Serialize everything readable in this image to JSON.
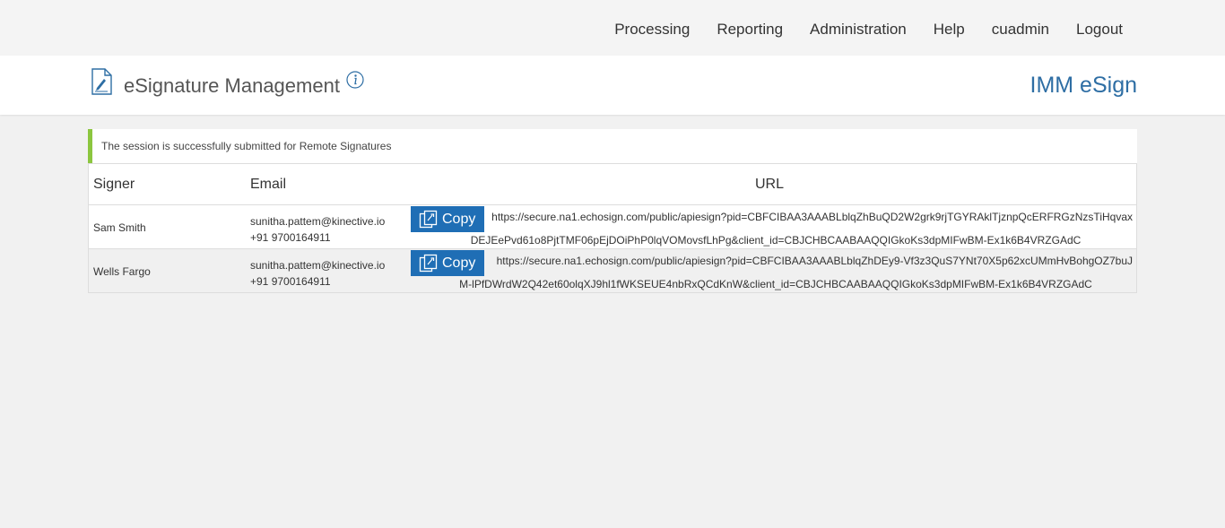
{
  "nav": {
    "items": [
      "Processing",
      "Reporting",
      "Administration",
      "Help",
      "cuadmin",
      "Logout"
    ]
  },
  "header": {
    "title": "eSignature Management",
    "brand": "IMM eSign",
    "doc_icon": "document-signature-icon",
    "info_icon": "info-icon"
  },
  "alert": {
    "message": "The session is successfully submitted for Remote Signatures",
    "accent": "#8cc63f"
  },
  "table": {
    "headers": {
      "signer": "Signer",
      "email": "Email",
      "url": "URL"
    },
    "copy_label": "Copy",
    "rows": [
      {
        "signer": "Sam Smith",
        "email": "sunitha.pattem@kinective.io",
        "phone": "+91 9700164911",
        "url_line1": "https://secure.na1.echosign.com/public/apiesign?pid=CBFCIBAA3AAABLblqZhBuQD2W2grk9rjTGYRAklTjznpQcERFRGzNzsTiHqvax",
        "url_line2": "DEJEePvd61o8PjtTMF06pEjDOiPhP0lqVOMovsfLhPg&client_id=CBJCHBCAABAAQQIGkoKs3dpMIFwBM-Ex1k6B4VRZGAdC"
      },
      {
        "signer": "Wells Fargo",
        "email": "sunitha.pattem@kinective.io",
        "phone": "+91 9700164911",
        "url_line1": "https://secure.na1.echosign.com/public/apiesign?pid=CBFCIBAA3AAABLblqZhDEy9-Vf3z3QuS7YNt70X5p62xcUMmHvBohgOZ7buJ",
        "url_line2": "M-lPfDWrdW2Q42et60olqXJ9hl1fWKSEUE4nbRxQCdKnW&client_id=CBJCHBCAABAAQQIGkoKs3dpMIFwBM-Ex1k6B4VRZGAdC"
      }
    ]
  },
  "colors": {
    "brand": "#2e6ea4",
    "button": "#1f6eb5"
  }
}
